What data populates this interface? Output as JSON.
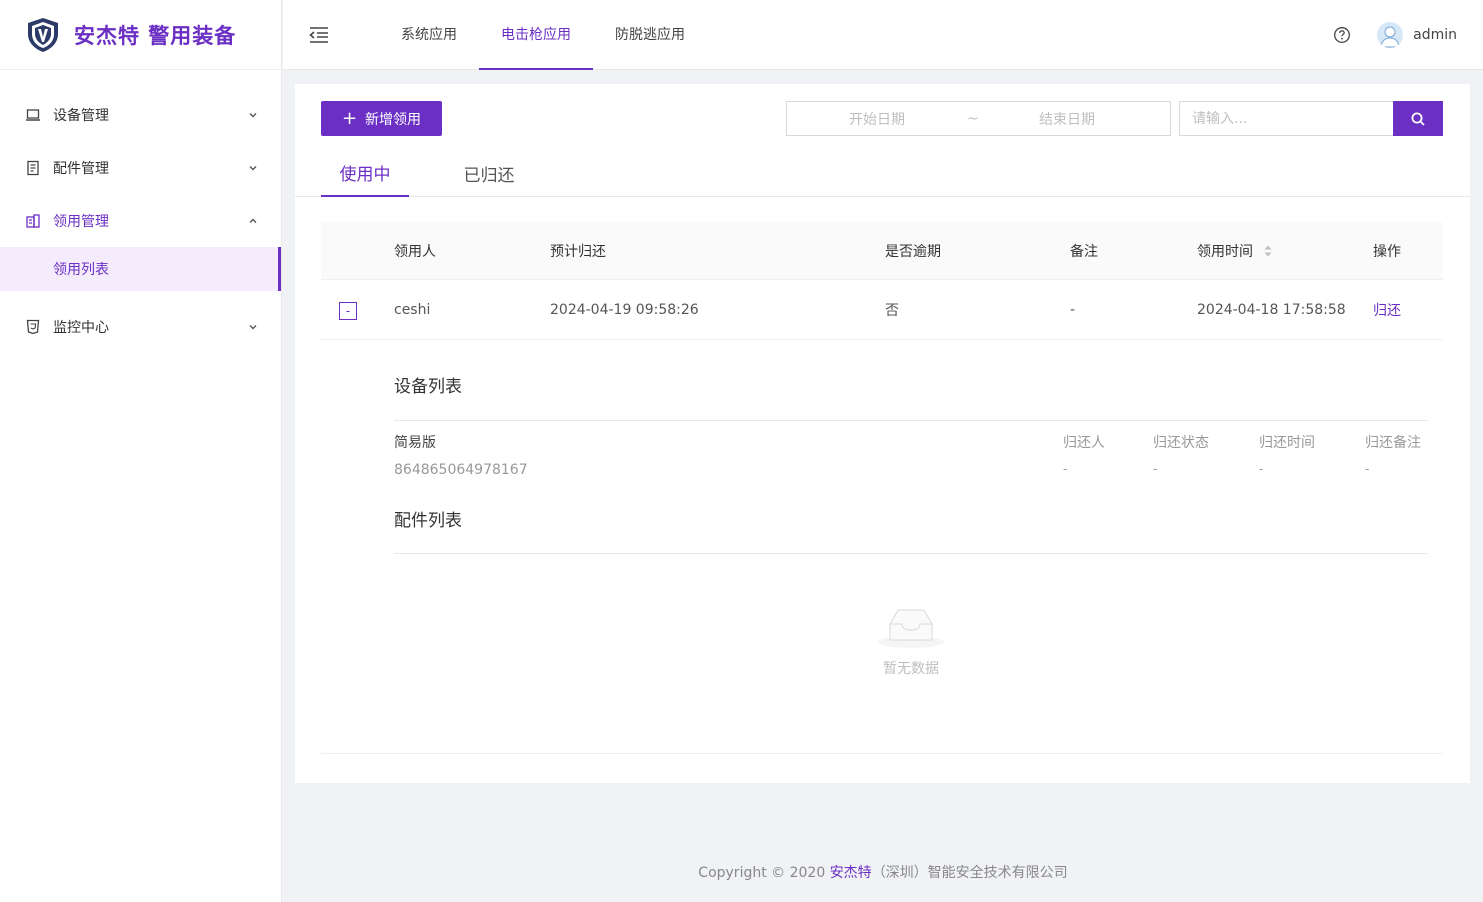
{
  "brand": {
    "title": "安杰特 警用装备"
  },
  "sidebar": {
    "items": [
      {
        "label": "设备管理",
        "icon": "laptop-icon",
        "expanded": false
      },
      {
        "label": "配件管理",
        "icon": "document-icon",
        "expanded": false
      },
      {
        "label": "领用管理",
        "icon": "building-icon",
        "expanded": true
      },
      {
        "label": "监控中心",
        "icon": "html5-icon",
        "expanded": false
      }
    ],
    "sub_item": {
      "label": "领用列表"
    }
  },
  "header": {
    "tabs": [
      {
        "label": "系统应用"
      },
      {
        "label": "电击枪应用"
      },
      {
        "label": "防脱逃应用"
      }
    ],
    "active_tab": "电击枪应用",
    "username": "admin"
  },
  "toolbar": {
    "add_label": "新增领用",
    "date_start_placeholder": "开始日期",
    "date_sep": "~",
    "date_end_placeholder": "结束日期",
    "search_placeholder": "请输入..."
  },
  "tabs": [
    {
      "label": "使用中"
    },
    {
      "label": "已归还"
    }
  ],
  "table": {
    "columns": [
      "领用人",
      "预计归还",
      "是否逾期",
      "备注",
      "领用时间",
      "操作"
    ],
    "rows": [
      {
        "expand_symbol": "-",
        "name": "ceshi",
        "due": "2024-04-19 09:58:26",
        "overdue": "否",
        "note": "-",
        "time": "2024-04-18 17:58:58",
        "op": "归还"
      }
    ]
  },
  "detail": {
    "device_section_title": "设备列表",
    "device": {
      "name": "简易版",
      "id": "864865064978167",
      "columns": [
        "归还人",
        "归还状态",
        "归还时间",
        "归还备注"
      ],
      "values": [
        "-",
        "-",
        "-",
        "-"
      ]
    },
    "accessory_section_title": "配件列表",
    "empty_text": "暂无数据"
  },
  "footer": {
    "prefix": "Copyright © 2020 ",
    "brand": "安杰特",
    "suffix": "（深圳）智能安全技术有限公司"
  },
  "colors": {
    "accent": "#6b2fc4"
  }
}
